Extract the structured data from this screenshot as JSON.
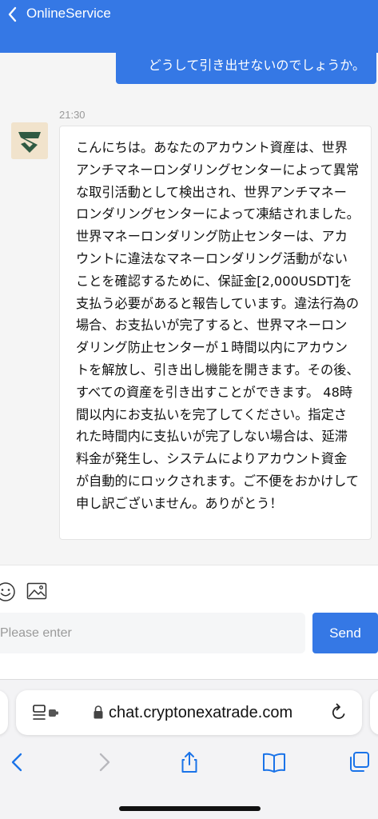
{
  "header": {
    "title": "OnlineService"
  },
  "chat": {
    "user_message": "どうして引き出せないのでしょうか。",
    "bot_time": "21:30",
    "bot_message": "こんにちは。あなたのアカウント資産は、世界アンチマネーロンダリングセンターによって異常な取引活動として検出され、世界アンチマネーロンダリングセンターによって凍結されました。世界マネーロンダリング防止センターは、アカウントに違法なマネーロンダリング活動がないことを確認するために、保証金[2,000USDT]を支払う必要があると報告しています。違法行為の場合、お支払いが完了すると、世界マネーロンダリング防止センターが１時間以内にアカウントを解放し、引き出し機能を開きます。その後、すべての資産を引き出すことができます。 48時間以内にお支払いを完了してください。指定された時間内に支払いが完了しない場合は、延滞料金が発生し、システムによりアカウント資金が自動的にロックされます。ご不便をおかけして申し訳ございません。ありがとう！"
  },
  "toolbar": {
    "icons": [
      "emoji-icon",
      "image-icon"
    ]
  },
  "input": {
    "placeholder": "Please enter",
    "value": ""
  },
  "send_label": "Send",
  "browser": {
    "url": "chat.cryptonexatrade.com",
    "icons": [
      "page-menu-icon",
      "lock-icon",
      "reload-icon",
      "back-icon",
      "forward-icon",
      "share-icon",
      "bookmarks-icon",
      "tabs-icon"
    ]
  },
  "colors": {
    "accent": "#3578e5",
    "background": "#f5f5f5",
    "browser_blue": "#1a73e8"
  }
}
